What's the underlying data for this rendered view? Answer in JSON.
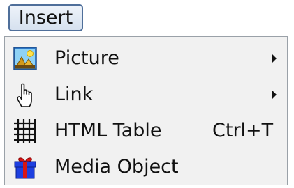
{
  "menu": {
    "title": "Insert",
    "items": [
      {
        "label": "Picture",
        "icon": "picture-icon",
        "submenu": true,
        "shortcut": ""
      },
      {
        "label": "Link",
        "icon": "link-hand-icon",
        "submenu": true,
        "shortcut": ""
      },
      {
        "label": "HTML Table",
        "icon": "table-grid-icon",
        "submenu": false,
        "shortcut": "Ctrl+T"
      },
      {
        "label": "Media Object",
        "icon": "gift-box-icon",
        "submenu": false,
        "shortcut": ""
      }
    ]
  },
  "colors": {
    "menu_title_border": "#4f6f9a",
    "menu_background": "#f1f1f1",
    "icon_blue": "#1d3fe0",
    "icon_red": "#d91414"
  }
}
